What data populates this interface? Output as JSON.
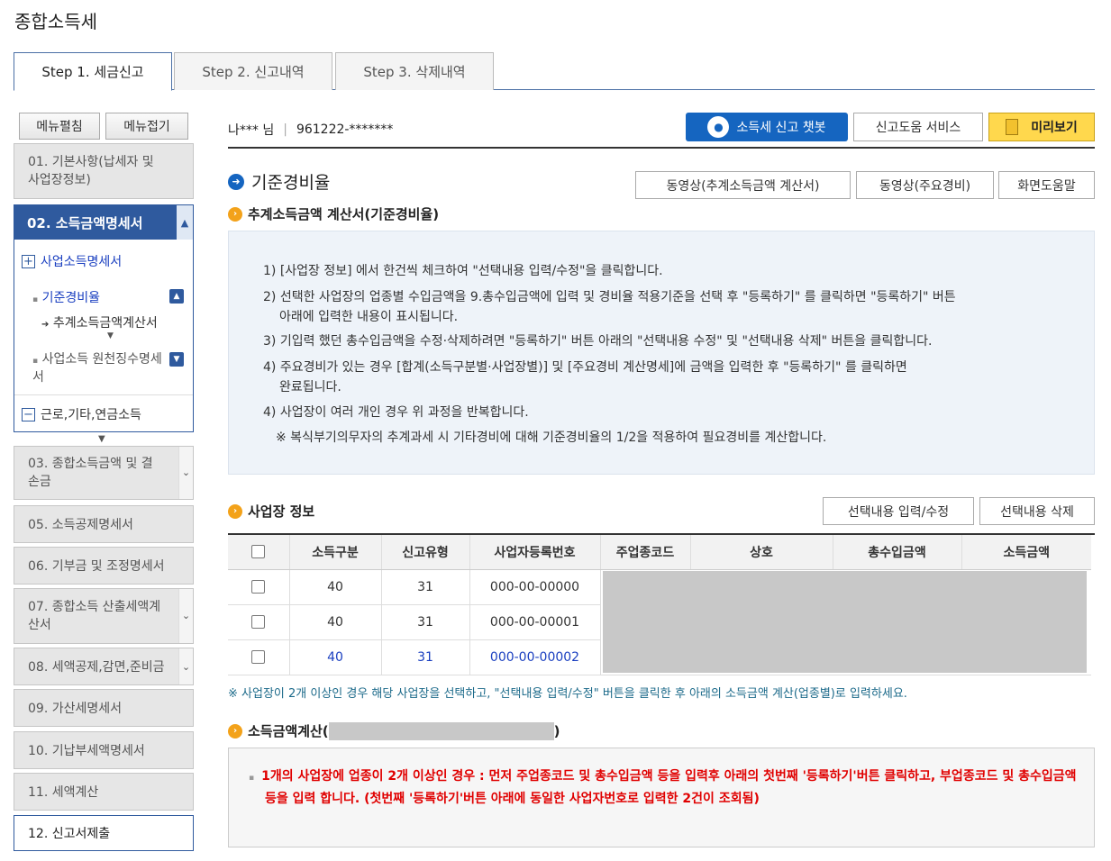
{
  "page_title": "종합소득세",
  "tabs": [
    "Step 1. 세금신고",
    "Step 2. 신고내역",
    "Step 3. 삭제내역"
  ],
  "user": {
    "name": "나*** 님",
    "sep": "|",
    "id": "961222-*******"
  },
  "header_buttons": {
    "chatbot": "소득세 신고 챗봇",
    "help_service": "신고도움 서비스",
    "preview": "미리보기"
  },
  "sidebar": {
    "expand_all": "메뉴펼침",
    "collapse_all": "메뉴접기",
    "item01": "01. 기본사항(납세자 및 사업장정보)",
    "item02": "02. 소득금액명세서",
    "sub_business": "사업소득명세서",
    "sub_standard": "기준경비율",
    "sub_estimate": "추계소득금액계산서",
    "sub_withholding": "사업소득 원천징수명세서",
    "sub_other": "근로,기타,연금소득",
    "item03": "03. 종합소득금액 및 결손금",
    "item05": "05. 소득공제명세서",
    "item06": "06. 기부금 및 조정명세서",
    "item07": "07. 종합소득 산출세액계산서",
    "item08": "08. 세액공제,감면,준비금",
    "item09": "09. 가산세명세서",
    "item10": "10. 기납부세액명세서",
    "item11": "11. 세액계산",
    "item12": "12. 신고서제출"
  },
  "main": {
    "heading": "기준경비율",
    "video_estimate": "동영상(추계소득금액 계산서)",
    "video_major": "동영상(주요경비)",
    "screen_help": "화면도움말",
    "calc_title": "추계소득금액 계산서(기준경비율)",
    "instructions": [
      "1) [사업장 정보] 에서 한건씩 체크하여 \"선택내용 입력/수정\"을 클릭합니다.",
      "2) 선택한 사업장의 업종별 수입금액을 9.총수입금액에 입력 및 경비율 적용기준을 선택 후 \"등록하기\" 를 클릭하면 \"등록하기\" 버튼",
      "아래에 입력한 내용이 표시됩니다.",
      "3) 기입력 했던 총수입금액을 수정·삭제하려면 \"등록하기\" 버튼 아래의 \"선택내용 수정\" 및 \"선택내용 삭제\" 버튼을 클릭합니다.",
      "4) 주요경비가 있는 경우 [합계(소득구분별·사업장별)] 및 [주요경비 계산명세]에 금액을 입력한 후 \"등록하기\" 를 클릭하면",
      "완료됩니다.",
      "4) 사업장이 여러 개인 경우 위 과정을 반복합니다.",
      "※ 복식부기의무자의 추계과세 시 기타경비에 대해 기준경비율의 1/2을 적용하여 필요경비를 계산합니다."
    ],
    "biz_title": "사업장 정보",
    "btn_edit": "선택내용 입력/수정",
    "btn_delete": "선택내용 삭제",
    "table": {
      "headers": [
        "소득구분",
        "신고유형",
        "사업자등록번호",
        "주업종코드",
        "상호",
        "총수입금액",
        "소득금액"
      ],
      "rows": [
        [
          "40",
          "31",
          "000-00-00000"
        ],
        [
          "40",
          "31",
          "000-00-00001"
        ],
        [
          "40",
          "31",
          "000-00-00002"
        ]
      ]
    },
    "table_note": "※ 사업장이 2개 이상인 경우 해당 사업장을 선택하고, \"선택내용 입력/수정\" 버튼을 클릭한 후 아래의 소득금액 계산(업종별)로 입력하세요.",
    "income_title_prefix": "소득금액계산(",
    "income_title_suffix": ")",
    "warning": "1개의 사업장에 업종이 2개 이상인 경우 : 먼저 주업종코드 및 총수입금액 등을 입력후 아래의 첫번째 '등록하기'버튼 클릭하고, 부업종코드 및 총수입금액 등을 입력 합니다. (첫번째 '등록하기'버튼 아래에 동일한 사업자번호로 입력한 2건이 조회됨)"
  },
  "colors": {
    "accent": "#4a6fa5",
    "sidebar_active": "#2f5a9e",
    "chatbot": "#1565c0",
    "preview": "#ffd84d",
    "warning": "#e00000",
    "link_blue": "#1a3fc0"
  },
  "icons": [
    "chatbot-icon",
    "arrow-circle-icon",
    "orange-bullet-icon",
    "plus-box-icon",
    "minus-box-icon",
    "chevron-up-icon",
    "chevron-down-icon",
    "document-icon"
  ]
}
